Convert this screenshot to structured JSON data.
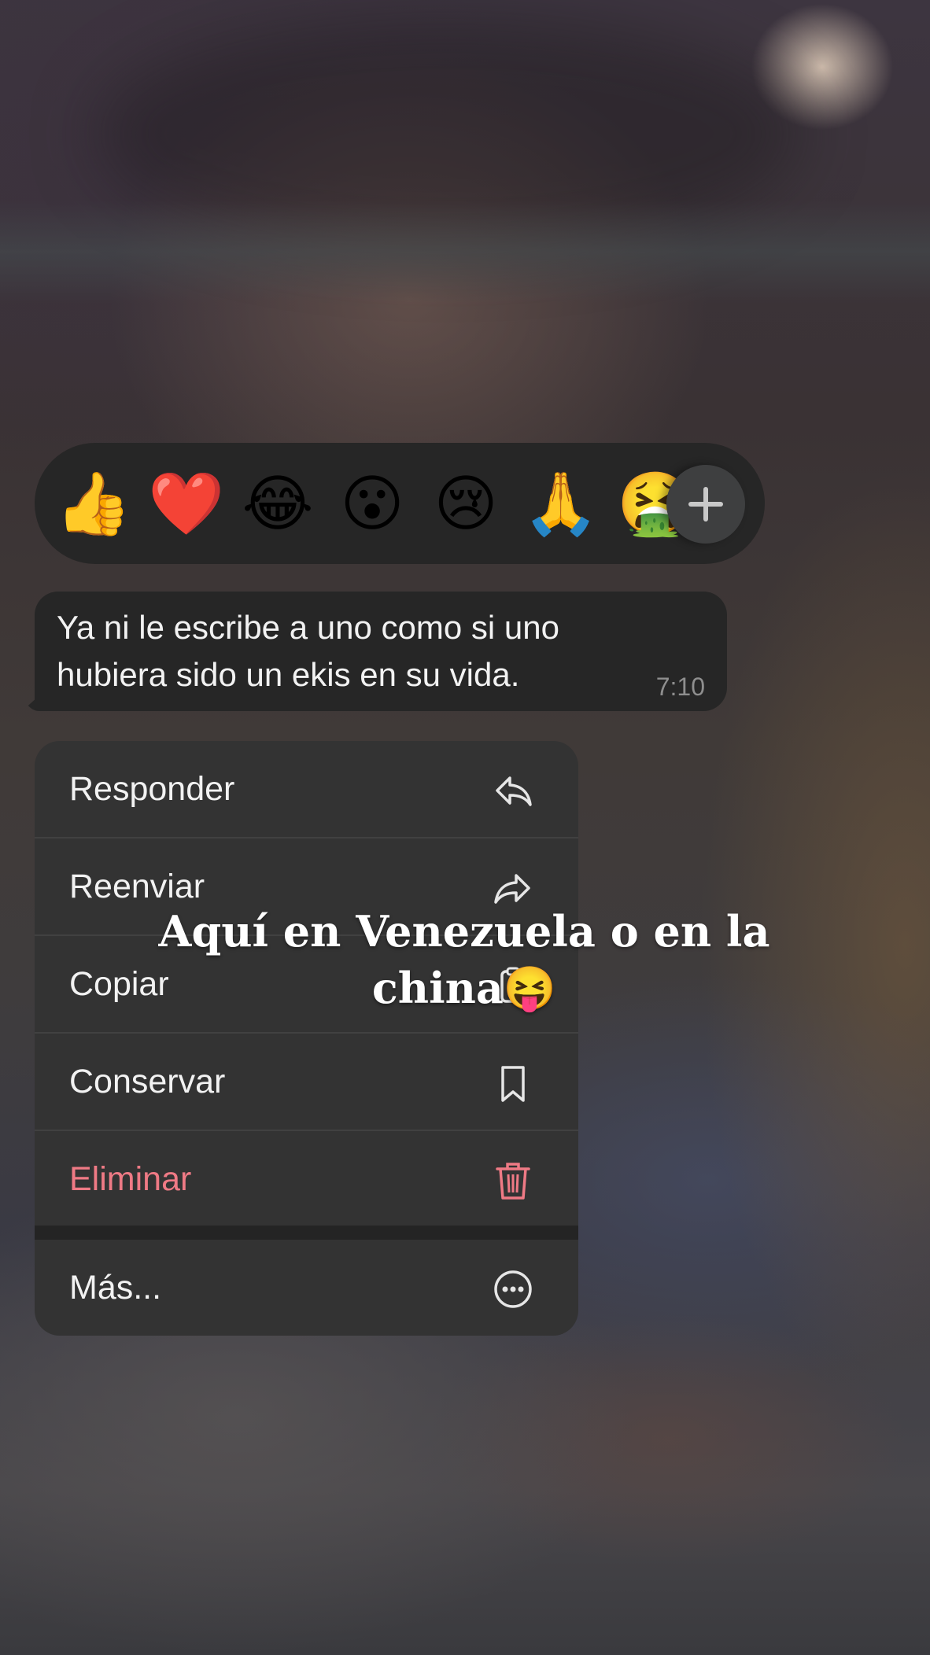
{
  "reactions": {
    "items": [
      {
        "emoji": "👍",
        "name": "thumbs-up"
      },
      {
        "emoji": "❤️",
        "name": "red-heart"
      },
      {
        "emoji": "😂",
        "name": "tears-of-joy"
      },
      {
        "emoji": "😮",
        "name": "open-mouth"
      },
      {
        "emoji": "😢",
        "name": "crying"
      },
      {
        "emoji": "🙏",
        "name": "folded-hands"
      },
      {
        "emoji": "🤮",
        "name": "vomiting"
      }
    ],
    "more_icon": "plus-icon"
  },
  "message": {
    "text": "Ya ni le escribe a uno como si uno hubiera sido un ekis en su vida.",
    "time": "7:10"
  },
  "menu": {
    "items": [
      {
        "label": "Responder",
        "icon": "reply-icon"
      },
      {
        "label": "Reenviar",
        "icon": "forward-icon"
      },
      {
        "label": "Copiar",
        "icon": "copy-icon"
      },
      {
        "label": "Conservar",
        "icon": "bookmark-icon"
      },
      {
        "label": "Eliminar",
        "icon": "trash-icon",
        "color": "#ef7a85"
      },
      {
        "label": "Más...",
        "icon": "more-icon"
      }
    ]
  },
  "caption": {
    "line1": "Aquí en Venezuela o en la",
    "line2": "china😝"
  }
}
